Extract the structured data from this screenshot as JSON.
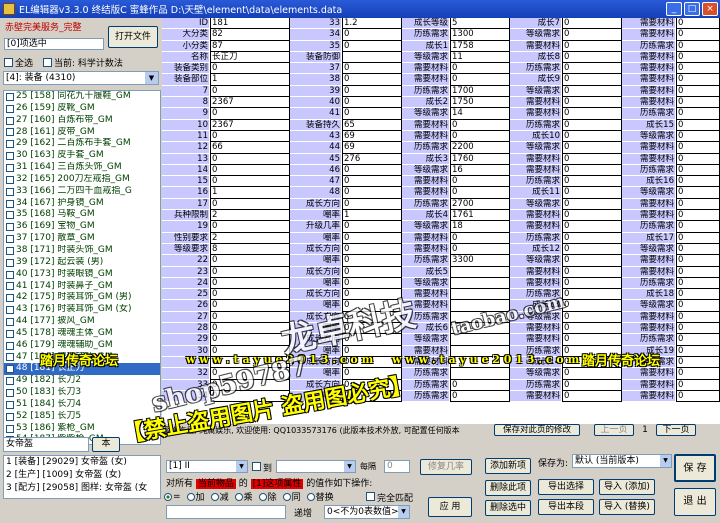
{
  "title_bar": {
    "text": "EL编辑器v3.3.0 终结版C   蜜蜂作品  D:\\天壁\\element\\data\\elements.data"
  },
  "left": {
    "game_label": "赤壁完美服务_完整",
    "selected_count": "[0]项选中",
    "open_file": "打开文件",
    "select_all": "全选",
    "current_label": "当前: 科学计数法",
    "category": "[4]: 装备 (4310)",
    "items": [
      "25 [158] 同花九十履鞋_GM",
      "26 [159] 皮靴_GM",
      "27 [160] 百炼布带_GM",
      "28 [161] 皮带_GM",
      "29 [162] 二百炼布手套_GM",
      "30 [163] 皮手套_GM",
      "31 [164] 三百炼头饰_GM",
      "32 [165] 200刀左戒指_GM",
      "33 [166] 二万四千血戒指_G",
      "34 [167] 护身镜_GM",
      "35 [168] 马鞍_GM",
      "36 [169] 宝物_GM",
      "37 [170] 散章_GM",
      "38 [171] 时装头饰_GM",
      "39 [172] 起云装 (男)",
      "40 [173] 时装眼镜_GM",
      "41 [174] 时装鼻子_GM",
      "42 [175] 时装耳饰_GM (男)",
      "43 [176] 时装耳饰_GM (女)",
      "44 [177] 披风_GM",
      "45 [178] 魂魂主体_GM",
      "46 [179] 魂魂辅助_GM",
      "47 [180] 魂魂辅助_GM",
      "48 [181] 长正刀",
      "49 [182] 长刀2",
      "50 [183] 长刀3",
      "51 [184] 长刀4",
      "52 [185] 长刀5",
      "53 [186] 紫枪_GM",
      "54 [187] 紫紫枪_GM",
      "55 [188] 紫紫护_GM",
      "56 [189] 紫青枪_GM"
    ],
    "selected_index": 23,
    "search_value": "女帝盔",
    "search_btn": "本",
    "results": [
      "1 [装备] [29029] 女帝盔 (女)",
      "2 [生产] [1009] 女帝盔 (女)",
      "3 [配方] [29058] 图样: 女帝盔 (女"
    ]
  },
  "grid": {
    "rows": [
      [
        "ID",
        "181",
        "33",
        "1.2",
        "成长等级",
        "5",
        "成长7",
        "0",
        "需要材料",
        "0"
      ],
      [
        "大分类",
        "82",
        "34",
        "0",
        "历练需求",
        "1300",
        "等级需求",
        "0",
        "需要材料",
        "0"
      ],
      [
        "小分类",
        "87",
        "35",
        "0",
        "成长1",
        "1758",
        "需要材料",
        "0",
        "历练需求",
        "0"
      ],
      [
        "名称",
        "长正刀",
        "装备防御",
        "",
        "等级需求",
        "11",
        "成长8",
        "0",
        "需要材料",
        "0"
      ],
      [
        "装备类别",
        "0",
        "37",
        "0",
        "需要材料",
        "0",
        "历练需求",
        "0",
        "需要材料",
        "0"
      ],
      [
        "装备部位",
        "1",
        "38",
        "0",
        "需要材料",
        "0",
        "成长9",
        "0",
        "需要材料",
        "0"
      ],
      [
        "7",
        "0",
        "39",
        "0",
        "历练需求",
        "1700",
        "等级需求",
        "0",
        "需要材料",
        "0"
      ],
      [
        "8",
        "2367",
        "40",
        "0",
        "成长2",
        "1750",
        "需要材料",
        "0",
        "需要材料",
        "0"
      ],
      [
        "9",
        "0",
        "41",
        "0",
        "等级需求",
        "14",
        "需要材料",
        "0",
        "历练需求",
        "0"
      ],
      [
        "10",
        "2367",
        "装备持久",
        "65",
        "需要材料",
        "0",
        "历练需求",
        "0",
        "成长15",
        "0"
      ],
      [
        "11",
        "0",
        "43",
        "69",
        "需要材料",
        "0",
        "成长10",
        "0",
        "等级需求",
        "0"
      ],
      [
        "12",
        "66",
        "44",
        "69",
        "历练需求",
        "2200",
        "等级需求",
        "0",
        "需要材料",
        "0"
      ],
      [
        "13",
        "0",
        "45",
        "276",
        "成长3",
        "1760",
        "需要材料",
        "0",
        "需要材料",
        "0"
      ],
      [
        "14",
        "0",
        "46",
        "0",
        "等级需求",
        "16",
        "需要材料",
        "0",
        "历练需求",
        "0"
      ],
      [
        "15",
        "0",
        "47",
        "0",
        "需要材料",
        "0",
        "历练需求",
        "0",
        "成长16",
        "0"
      ],
      [
        "16",
        "1",
        "48",
        "0",
        "需要材料",
        "0",
        "成长11",
        "0",
        "等级需求",
        "0"
      ],
      [
        "17",
        "0",
        "成长方向",
        "0",
        "历练需求",
        "2700",
        "等级需求",
        "0",
        "需要材料",
        "0"
      ],
      [
        "兵种限制",
        "2",
        "嘲率",
        "1",
        "成长4",
        "1761",
        "需要材料",
        "0",
        "需要材料",
        "0"
      ],
      [
        "19",
        "0",
        "升级几率",
        "0",
        "等级需求",
        "18",
        "需要材料",
        "0",
        "历练需求",
        "0"
      ],
      [
        "性别要求",
        "2",
        "嘲率",
        "0",
        "需要材料",
        "0",
        "历练需求",
        "0",
        "成长17",
        "0"
      ],
      [
        "等级要求",
        "8",
        "成长方向",
        "0",
        "需要材料",
        "0",
        "成长12",
        "0",
        "等级需求",
        "0"
      ],
      [
        "22",
        "0",
        "嘲率",
        "0",
        "历练需求",
        "3300",
        "等级需求",
        "0",
        "需要材料",
        "0"
      ],
      [
        "23",
        "0",
        "成长方向",
        "0",
        "成长5",
        "",
        "需要材料",
        "0",
        "需要材料",
        "0"
      ],
      [
        "24",
        "0",
        "嘲率",
        "0",
        "等级需求",
        "",
        "需要材料",
        "0",
        "历练需求",
        "0"
      ],
      [
        "25",
        "0",
        "成长方向",
        "0",
        "需要材料",
        "",
        "历练需求",
        "0",
        "成长18",
        "0"
      ],
      [
        "26",
        "0",
        "嘲率",
        "0",
        "需要材料",
        "",
        "成长13",
        "0",
        "等级需求",
        "0"
      ],
      [
        "27",
        "0",
        "成长方向",
        "0",
        "历练需求",
        "",
        "等级需求",
        "0",
        "需要材料",
        "0"
      ],
      [
        "28",
        "0",
        "嘲率",
        "0",
        "成长6",
        "",
        "需要材料",
        "0",
        "需要材料",
        "0"
      ],
      [
        "29",
        "0",
        "成长方向",
        "0",
        "等级需求",
        "",
        "需要材料",
        "0",
        "历练需求",
        "0"
      ],
      [
        "30",
        "0",
        "嘲率",
        "0",
        "需要材料",
        "",
        "历练需求",
        "0",
        "成长19",
        "0"
      ],
      [
        "31",
        "0",
        "成长方向",
        "0",
        "需要材料",
        "",
        "成长14",
        "0",
        "等级需求",
        "0"
      ],
      [
        "32",
        "0",
        "嘲率",
        "0",
        "历练需求",
        "",
        "等级需求",
        "0",
        "需要材料",
        "0"
      ],
      [
        "33",
        "0",
        "成长方向",
        "0",
        "历练需求",
        "0",
        "历练需求",
        "0",
        "需要材料",
        "0"
      ],
      [
        "34",
        "0",
        "嘲率",
        "0",
        "历练需求",
        "0",
        "需要材料",
        "0",
        "需要材料",
        "0"
      ]
    ]
  },
  "status": {
    "text": "蜜蜂作品, 纯属娱乐, 欢迎使用: QQ1033573176 (此版本技术外放, 可配置任何版本",
    "save_page": "保存对此页的修改",
    "prev": "上一页",
    "page": "1",
    "next": "下一页"
  },
  "controls": {
    "field_select": "[1] II",
    "to_label": "到",
    "interval_label": "每隔",
    "interval_value": "0",
    "modify_btn": "修复几率",
    "target_prefix": "对所有",
    "target_red": "当前物品",
    "target_mid": "的",
    "target_red2": "[1]这项属性",
    "target_suffix": "的值作如下操作:",
    "ops": [
      "=",
      "加",
      "减",
      "乘",
      "除",
      "同",
      "替换"
    ],
    "full_match": "完全匹配",
    "decrement_label": "递增",
    "decrement_select": "0<不为0表数值>",
    "apply": "应 用",
    "add_new": "添加新项",
    "del_this": "删除此项",
    "del_selected": "删除选中",
    "save_as_label": "保存为:",
    "save_as_value": "默认 (当前版本)",
    "export_selected": "导出选择",
    "import_add": "导入 (添加)",
    "export_this": "导出本段",
    "import_replace": "导入 (替换)",
    "save": "保 存",
    "exit": "退 出"
  },
  "watermarks": {
    "forum1": "踏月传奇论坛",
    "url1": "w w w . t a y u e 2 0 1 3 . c o m",
    "url2": "w w w . t a y u e 2 0 1 3 . c o m",
    "forum2": "踏月传奇论坛",
    "brand": "龙卓科技",
    "shop": "shop59787",
    "forbid": "【禁止盗用图片 盗用图必究】",
    "taobao": "taobao.com"
  }
}
